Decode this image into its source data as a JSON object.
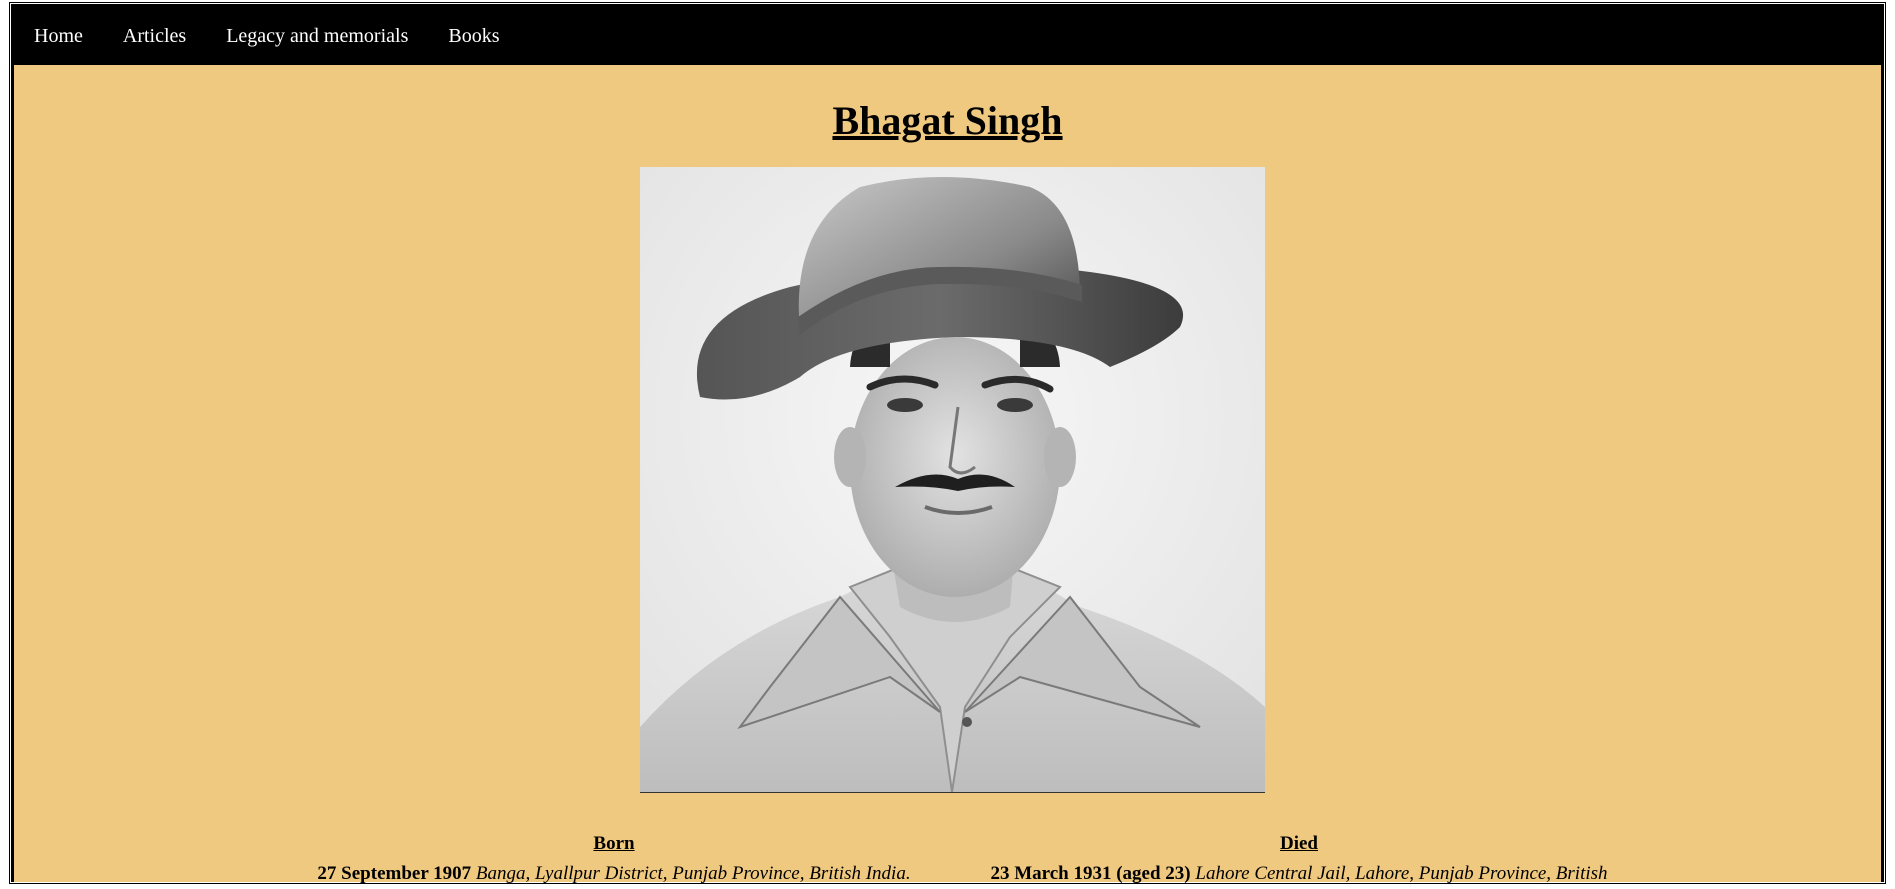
{
  "nav": {
    "items": [
      {
        "label": "Home"
      },
      {
        "label": "Articles"
      },
      {
        "label": "Legacy and memorials"
      },
      {
        "label": "Books"
      }
    ]
  },
  "page": {
    "title": "Bhagat Singh"
  },
  "born": {
    "label": "Born",
    "date": "27 September 1907",
    "place": "Banga, Lyallpur District, Punjab Province, British India."
  },
  "died": {
    "label": "Died",
    "date": "23 March 1931 (aged 23)",
    "place": "Lahore Central Jail, Lahore, Punjab Province, British"
  },
  "colors": {
    "background": "#f0c981",
    "nav_background": "#000000",
    "nav_text": "#ffffff"
  }
}
